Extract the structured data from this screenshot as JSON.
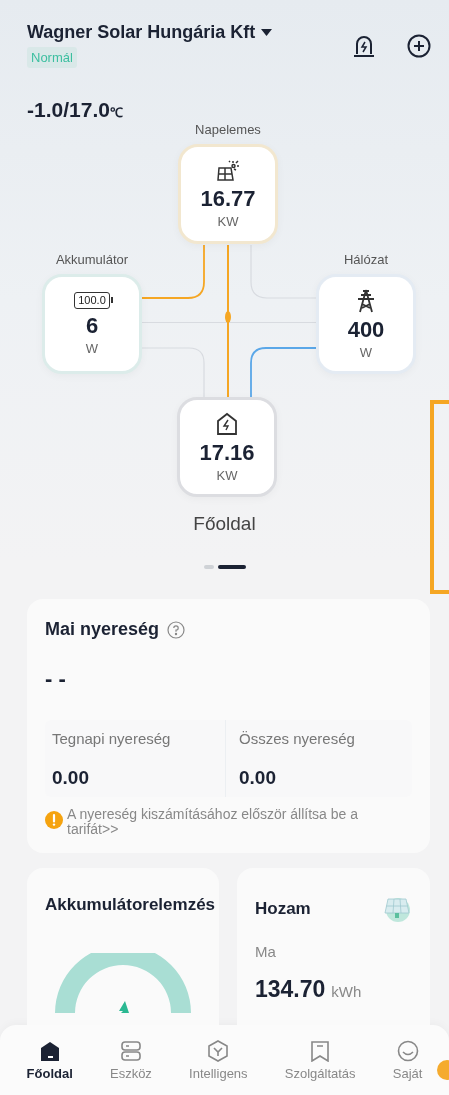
{
  "header": {
    "title": "Wagner Solar Hungária Kft",
    "status": "Normál",
    "temperature": "-1.0/17.0",
    "temperature_unit": "℃"
  },
  "energy_flow": {
    "nodes": [
      {
        "kind": "solar",
        "label": "Napelemes",
        "value": "16.77",
        "unit": "KW"
      },
      {
        "kind": "battery",
        "label": "Akkumulátor",
        "value": "6",
        "unit": "W",
        "battery_text": "100.0"
      },
      {
        "kind": "grid",
        "label": "Hálózat",
        "value": "400",
        "unit": "W"
      },
      {
        "kind": "home",
        "value": "17.16",
        "unit": "KW"
      }
    ],
    "flows": [
      {
        "active": true,
        "color": "#f5a623"
      },
      {
        "active": true,
        "color": "#f5a623"
      },
      {
        "active": true,
        "color": "#5aa7e8"
      },
      {
        "active": false
      },
      {
        "active": false
      },
      {
        "active": false
      }
    ],
    "caption": "Főoldal"
  },
  "pager": [
    {
      "selected": false
    },
    {
      "selected": true
    }
  ],
  "profit_card": {
    "title": "Mai nyereség",
    "value": "- -",
    "stats": [
      {
        "label": "Tegnapi nyereség",
        "value": "0.00"
      },
      {
        "label": "Összes nyereség",
        "value": "0.00"
      }
    ],
    "notice": "A nyereség kiszámításához először állítsa be a tarifát>>"
  },
  "battery_card": {
    "title": "Akkumulátorelemzés"
  },
  "yield_card": {
    "title": "Hozam",
    "period": "Ma",
    "value": "134.70",
    "unit": "kWh"
  },
  "tab_bar": [
    {
      "kind": "home",
      "label": "Főoldal",
      "selected": true
    },
    {
      "kind": "device",
      "label": "Eszköz",
      "selected": false
    },
    {
      "kind": "smart",
      "label": "Intelligens",
      "selected": false
    },
    {
      "kind": "service",
      "label": "Szolgáltatás",
      "selected": false
    },
    {
      "kind": "profile",
      "label": "Saját",
      "selected": false
    }
  ]
}
